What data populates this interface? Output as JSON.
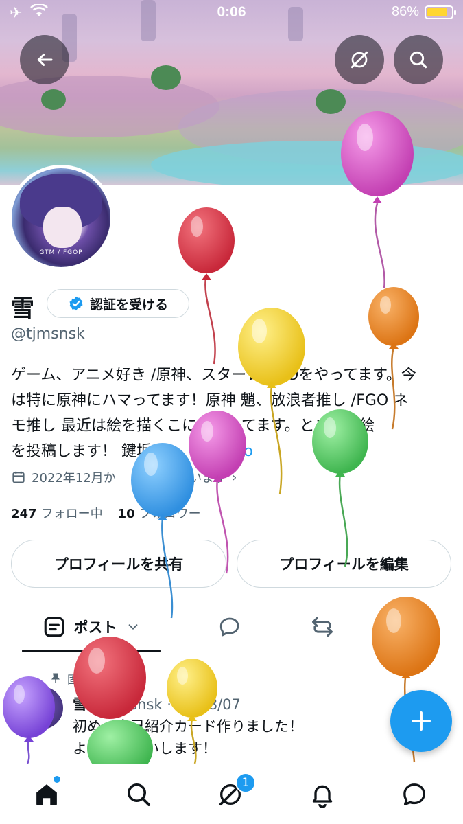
{
  "status_bar": {
    "time": "0:06",
    "battery_percent": "86%",
    "battery_level": 0.86,
    "left_icons": [
      "airplane-icon",
      "wifi-icon"
    ]
  },
  "header": {
    "back_icon": "back-arrow-icon",
    "grok_icon": "grok-icon",
    "search_icon": "search-icon"
  },
  "avatar": {
    "caption": "GTM / FGOP"
  },
  "profile": {
    "name": "雪",
    "verify_label": "認証を受ける",
    "handle": "@tjmsnsk",
    "bio_lines": [
      "ゲーム、アニメ好き /原神、スターレ FGOをやってます。今",
      "は特に原神にハマってます！原神 魈、放浪者推し /FGO ネ",
      "モ推し 最近は絵を描くこにハマってます。ときどき絵",
      "を投稿します！ 鍵垢→"
    ],
    "bio_link": "@　　　18o",
    "joined": "2022年12月か　　　用しています",
    "following_count": "247",
    "following_label": "フォロー中",
    "followers_count": "10",
    "followers_label": "フォロワー"
  },
  "buttons": {
    "share_profile": "プロフィールを共有",
    "edit_profile": "プロフィールを編集"
  },
  "tabs": {
    "posts_label": "ポスト",
    "posts_icon": "posts-icon",
    "replies_icon": "reply-icon",
    "reposts_icon": "repost-icon"
  },
  "post": {
    "pinned_label": "固",
    "author": "雪",
    "meta": "@tjmsnsk · 24/08/07",
    "line1": "初め　自己紹介カード作りました！",
    "line2": "よ　　　願いします！"
  },
  "bottom_nav": {
    "items": [
      "home-icon",
      "search-icon",
      "grok-icon",
      "bell-icon",
      "messages-icon"
    ],
    "grok_badge": "1"
  },
  "colors": {
    "accent": "#1d9bf0",
    "text": "#0f1419",
    "muted": "#536471",
    "border": "#cfd9de"
  }
}
